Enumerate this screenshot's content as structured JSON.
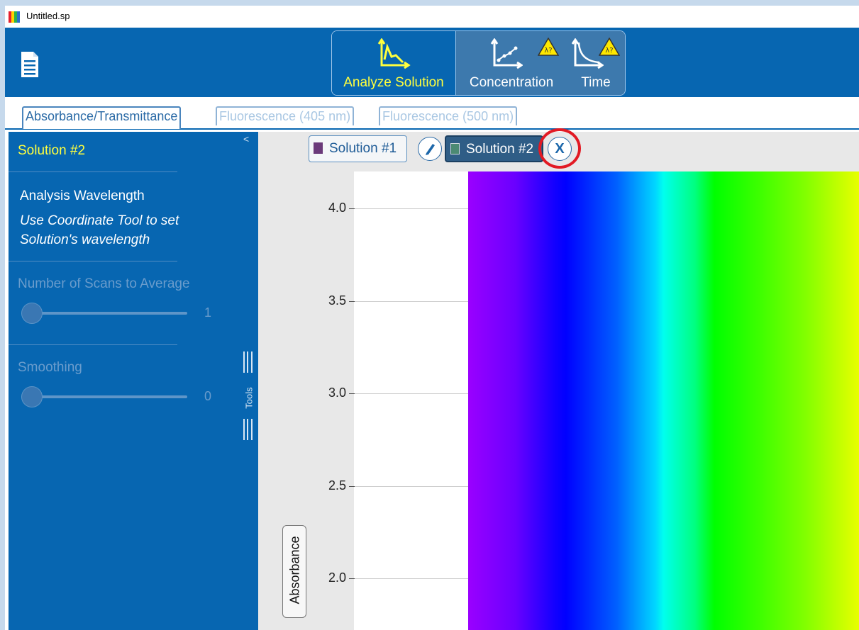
{
  "window": {
    "title": "Untitled.sp"
  },
  "toolbar": {
    "modes": [
      {
        "label": "Analyze Solution",
        "icon": "analyze-spectrum-icon",
        "active": true
      },
      {
        "label": "Concentration",
        "icon": "concentration-plot-icon",
        "warning_badge": "λ?"
      },
      {
        "label": "Time",
        "icon": "time-plot-icon",
        "warning_badge": "λ?"
      }
    ]
  },
  "tabs": [
    {
      "label": "Absorbance/Transmittance",
      "active": true
    },
    {
      "label": "Fluorescence (405 nm)",
      "active": false
    },
    {
      "label": "Fluorescence (500 nm)",
      "active": false
    }
  ],
  "sidebar": {
    "collapse_glyph": "<",
    "solution_title": "Solution #2",
    "analysis_wavelength_label": "Analysis Wavelength",
    "analysis_wavelength_hint": "Use Coordinate Tool to set Solution's wavelength",
    "scans_label": "Number of Scans to Average",
    "scans_value": "1",
    "smoothing_label": "Smoothing",
    "smoothing_value": "0",
    "tools_label": "Tools"
  },
  "solutions": {
    "items": [
      {
        "label": "Solution #1",
        "color": "#6b3a7a"
      },
      {
        "label": "Solution #2",
        "color": "#4c8a73",
        "selected": true
      }
    ],
    "delete_label": "X"
  },
  "chart": {
    "ylabel": "Absorbance",
    "yticks": [
      "4.0",
      "3.5",
      "3.0",
      "2.5",
      "2.0"
    ]
  },
  "colors": {
    "toolbar_blue": "#0766b1",
    "active_yellow": "#ffff3e",
    "highlight_red": "#e21a24"
  }
}
